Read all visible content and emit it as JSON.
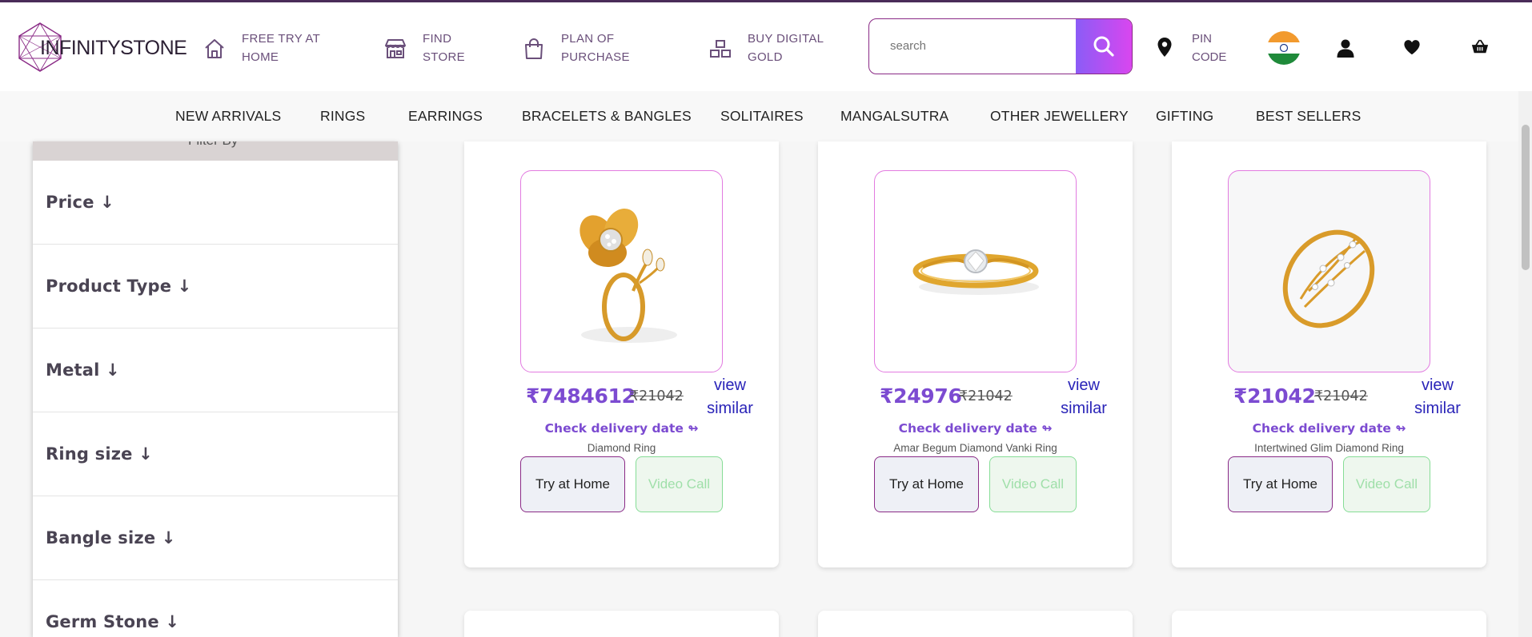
{
  "brand": {
    "name": "INFINITYSTONE"
  },
  "header_nav": [
    {
      "label": "FREE TRY AT HOME",
      "line1": "FREE TRY AT",
      "line2": "HOME",
      "icon": "home-icon"
    },
    {
      "label": "FIND STORE",
      "line1": "FIND",
      "line2": "STORE",
      "icon": "store-icon"
    },
    {
      "label": "PLAN OF PURCHASE",
      "line1": "PLAN OF",
      "line2": "PURCHASE",
      "icon": "shopping-bag-icon"
    },
    {
      "label": "BUY DIGITAL GOLD",
      "line1": "BUY DIGITAL",
      "line2": "GOLD",
      "icon": "gold-bars-icon"
    }
  ],
  "search": {
    "placeholder": "search",
    "value": ""
  },
  "pincode": {
    "line1": "PIN",
    "line2": "CODE",
    "icon": "location-pin-icon"
  },
  "header_icons": [
    "india-flag-icon",
    "user-icon",
    "heart-icon",
    "basket-icon"
  ],
  "categories": [
    "NEW ARRIVALS",
    "RINGS",
    "EARRINGS",
    "BRACELETS & BANGLES",
    "SOLITAIRES",
    "MANGALSUTRA",
    "OTHER JEWELLERY",
    "GIFTING",
    "BEST SELLERS"
  ],
  "filter": {
    "title": "Filter By",
    "items": [
      "Price ↓",
      "Product Type ↓",
      "Metal ↓",
      "Ring size ↓",
      "Bangle size ↓",
      "Germ Stone ↓"
    ]
  },
  "products": [
    {
      "price": "₹7484612",
      "mrp": "₹21042",
      "view_line1": "view",
      "view_line2": "similar",
      "check": "Check delivery date ↬",
      "name": "Diamond Ring",
      "try": "Try at Home",
      "video": "Video Call"
    },
    {
      "price": "₹24976",
      "mrp": "₹21042",
      "view_line1": "view",
      "view_line2": "similar",
      "check": "Check delivery date ↬",
      "name": "Amar Begum Diamond Vanki Ring",
      "try": "Try at Home",
      "video": "Video Call"
    },
    {
      "price": "₹21042",
      "mrp": "₹21042",
      "view_line1": "view",
      "view_line2": "similar",
      "check": "Check delivery date ↬",
      "name": "Intertwined Glim Diamond Ring",
      "try": "Try at Home",
      "video": "Video Call"
    }
  ],
  "colors": {
    "accent": "#7c4bd1",
    "brand_purple": "#8a2a86",
    "search_gradient_start": "#8b5cf6",
    "search_gradient_end": "#d946ef"
  }
}
